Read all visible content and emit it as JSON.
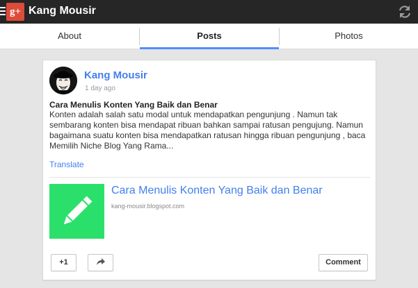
{
  "app": {
    "title": "Kang Mousir",
    "logo_text": "g+"
  },
  "tabs": [
    {
      "label": "About"
    },
    {
      "label": "Posts"
    },
    {
      "label": "Photos"
    }
  ],
  "post": {
    "author": "Kang Mousir",
    "timestamp": "1 day ago",
    "title": "Cara Menulis Konten Yang Baik dan Benar",
    "body": "Konten adalah salah satu modal untuk mendapatkan pengunjung . Namun tak sembarang konten bisa mendapat ribuan bahkan sampai ratusan pengujung. Namun bagaimana suatu konten bisa mendapatkan ratusan hingga ribuan pengunjung , baca Memilih Niche Blog Yang Rama...",
    "translate_label": "Translate",
    "link": {
      "title": "Cara Menulis Konten Yang Baik dan Benar",
      "domain": "kang-mousir.blogspot.com"
    },
    "actions": {
      "plusone_label": "+1",
      "comment_label": "Comment"
    }
  },
  "colors": {
    "accent": "#4d90fe",
    "link": "#427fed",
    "brand": "#dd4b39",
    "thumb": "#2be06a",
    "topbar": "#262626"
  },
  "icons": [
    "menu-icon",
    "google-plus-logo",
    "refresh-icon",
    "pencil-icon",
    "share-icon"
  ]
}
